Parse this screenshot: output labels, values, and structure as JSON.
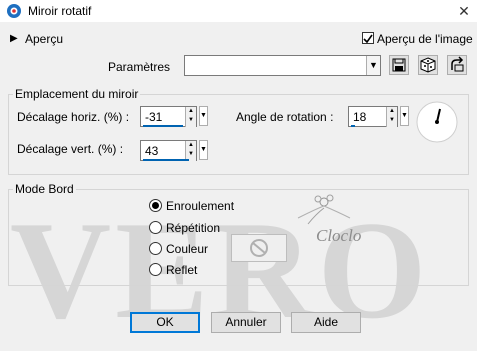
{
  "window": {
    "title": "Miroir rotatif",
    "close_glyph": "✕"
  },
  "preview": {
    "toggle_label": "Aperçu",
    "image_preview_label": "Aperçu de l'image",
    "image_preview_checked": true
  },
  "presets": {
    "label": "Paramètres",
    "value": ""
  },
  "mirror_group": {
    "title": "Emplacement du miroir",
    "horiz_label": "Décalage horiz. (%) :",
    "horiz_value": "-31",
    "vert_label": "Décalage vert. (%) :",
    "vert_value": "43",
    "angle_label": "Angle de rotation :",
    "angle_value": "18"
  },
  "edge_group": {
    "title": "Mode Bord",
    "options": [
      {
        "label": "Enroulement",
        "selected": true
      },
      {
        "label": "Répétition",
        "selected": false
      },
      {
        "label": "Couleur",
        "selected": false
      },
      {
        "label": "Reflet",
        "selected": false
      }
    ]
  },
  "brand_watermark": "Cloclo",
  "buttons": {
    "ok": "OK",
    "cancel": "Annuler",
    "help": "Aide"
  },
  "colors": {
    "accent": "#0063b1",
    "background": "#f0f0f0"
  }
}
